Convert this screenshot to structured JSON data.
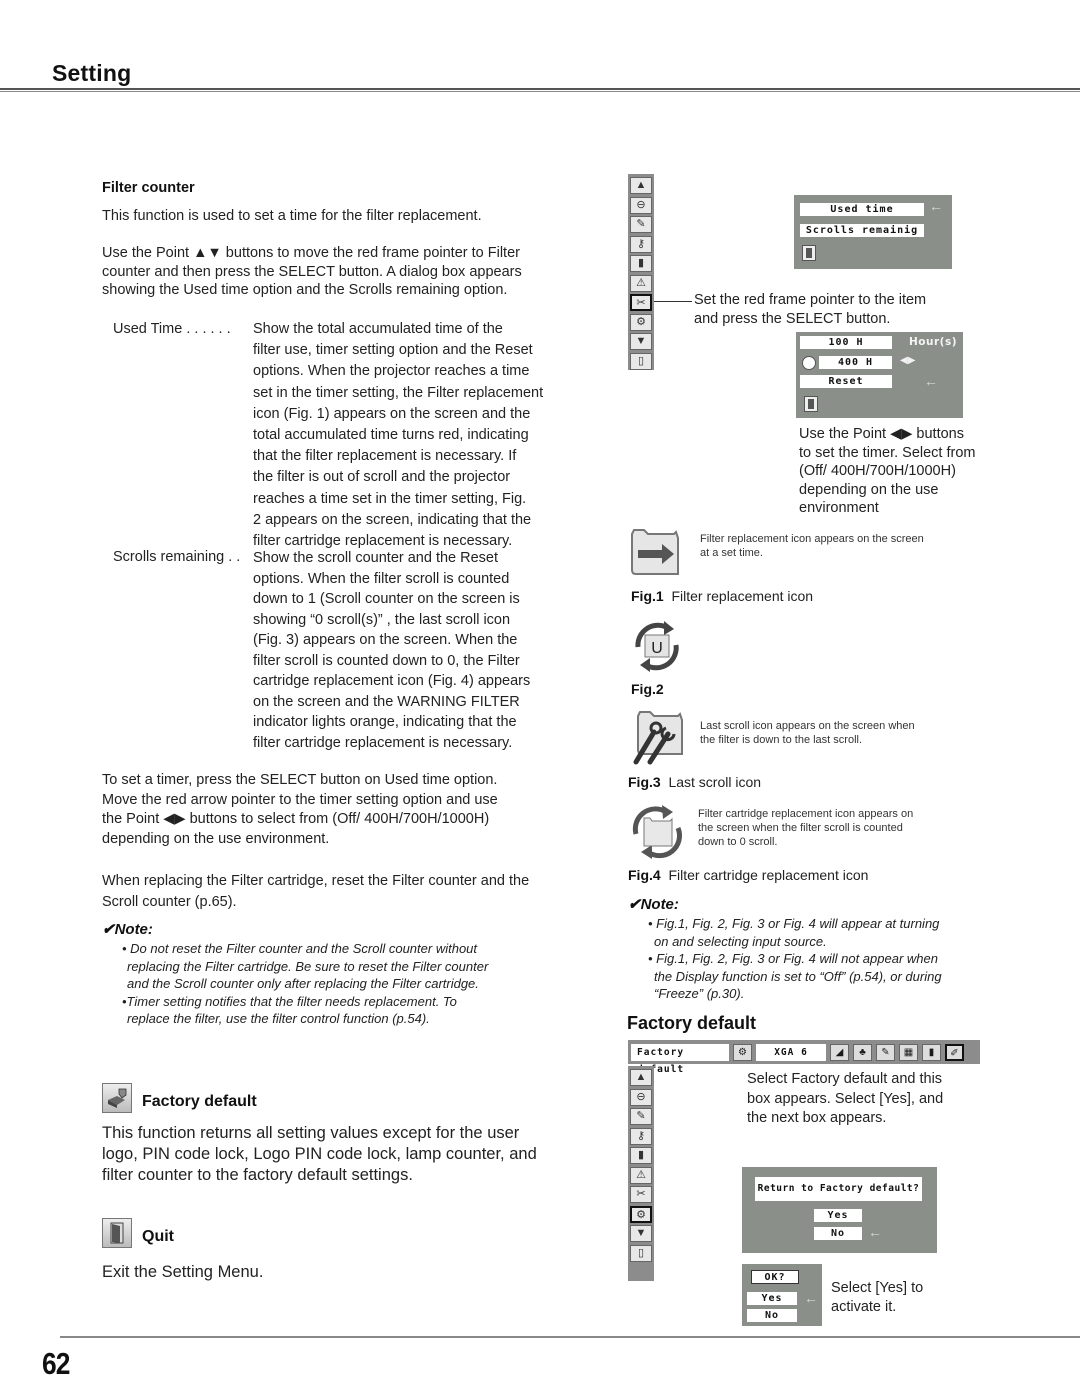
{
  "header": {
    "title": "Setting"
  },
  "left": {
    "filter_counter": {
      "heading": "Filter counter",
      "intro": "This function is used to set a time for the filter replacement.",
      "para1_lines": [
        "Use the Point ▲▼ buttons to move the red frame pointer to Filter",
        "counter and then press the SELECT button. A dialog box appears",
        "showing the Used time option and the Scrolls remaining option."
      ],
      "used_time": {
        "term": "Used Time . . . . . .",
        "lines": [
          "Show the total accumulated time of the",
          "filter use, timer setting option and the Reset",
          "options. When the projector reaches a time",
          "set in the timer setting, the Filter replacement",
          "icon (Fig. 1) appears on the screen and the",
          "total accumulated time turns red, indicating",
          "that the filter replacement is necessary. If",
          "the filter is out of scroll and the projector",
          "reaches a time set in the timer setting, Fig.",
          "2 appears on the screen, indicating that the",
          "filter cartridge replacement is necessary."
        ]
      },
      "scrolls_remaining": {
        "term": "Scrolls remaining . .",
        "lines": [
          "Show the scroll counter and the Reset",
          "options. When the filter scroll is counted",
          "down to 1 (Scroll counter on the screen is",
          "showing “0 scroll(s)” , the last scroll icon",
          "(Fig. 3) appears on the screen. When the",
          "filter scroll is counted down to 0, the Filter",
          "cartridge replacement icon (Fig. 4) appears",
          "on the screen and the WARNING FILTER",
          "indicator lights orange, indicating that the",
          "filter cartridge replacement is necessary."
        ]
      },
      "para2_lines": [
        "To set a timer, press the SELECT button on Used time option.",
        "Move the red arrow pointer to the timer setting option and use",
        "the Point ◀▶ buttons to select from (Off/ 400H/700H/1000H)",
        "depending on the use environment."
      ],
      "para3_lines": [
        "When replacing the Filter cartridge, reset the Filter counter and the",
        "Scroll counter (p.65)."
      ],
      "note": {
        "heading": "✔Note:",
        "items": [
          [
            "• Do not reset the Filter counter and the Scroll counter without",
            "replacing the Filter cartridge.  Be sure to reset the Filter counter",
            "and the Scroll counter only after replacing the Filter cartridge."
          ],
          [
            "•Timer setting notifies that the filter needs replacement. To",
            "replace the filter, use the filter control function (p.54)."
          ]
        ]
      }
    },
    "factory_default": {
      "heading": "Factory default",
      "icon": "factory-default-icon",
      "lines": [
        "This function returns all setting values except for the user",
        "logo, PIN code lock, Logo PIN code lock, lamp counter, and",
        "filter counter to the factory default settings."
      ]
    },
    "quit": {
      "heading": "Quit",
      "icon": "quit-door-icon",
      "text": "Exit the Setting Menu."
    }
  },
  "right": {
    "side_menu_icons": [
      "up-arrow-icon",
      "input-icon",
      "logo-icon",
      "key-icon",
      "display-icon",
      "warning-icon",
      "filter-counter-icon",
      "factory-default-icon",
      "down-arrow-icon",
      "quit-door-icon"
    ],
    "filter_dialog": {
      "items": [
        "Used time",
        "Scrolls remainig"
      ],
      "pointer": "←"
    },
    "callout1": [
      "Set the red frame pointer to the item",
      "and press the SELECT button."
    ],
    "timer_dialog": {
      "used_value": "100 H",
      "used_unit": "Hour(s)",
      "timer_value": "400 H",
      "timer_arrows": "◀▶",
      "reset": "Reset",
      "pointer": "←"
    },
    "callout2": [
      "Use the Point ◀▶ buttons",
      "to set the timer. Select from",
      "(Off/ 400H/700H/1000H)",
      "depending on the use",
      "environment"
    ],
    "figs": [
      {
        "desc": [
          "Filter replacement icon appears on the screen",
          "at a set time."
        ],
        "num": "Fig.1",
        "label": "Filter replacement icon",
        "icon": "filter-replacement-icon"
      },
      {
        "desc": [],
        "num": "Fig.2",
        "label": "",
        "icon": "filter-cycle-u-icon"
      },
      {
        "desc": [
          "Last scroll icon appears on the screen when",
          "the filter is down to the last scroll."
        ],
        "num": "Fig.3",
        "label": "Last scroll icon",
        "icon": "last-scroll-icon"
      },
      {
        "desc": [
          "Filter cartridge replacement icon appears on",
          "the screen when the filter scroll is counted",
          "down to 0 scroll."
        ],
        "num": "Fig.4",
        "label": "Filter cartridge replacement icon",
        "icon": "filter-cartridge-icon"
      }
    ],
    "note": {
      "heading": "✔Note:",
      "items": [
        [
          "• Fig.1, Fig. 2, Fig. 3 or Fig. 4 will appear at turning",
          "on and selecting input source."
        ],
        [
          "• Fig.1, Fig. 2, Fig. 3 or Fig. 4 will not appear when",
          "the Display function is set to “Off” (p.54), or during",
          "“Freeze” (p.30)."
        ]
      ]
    },
    "factory_default": {
      "heading": "Factory default",
      "menubar_label": "Factory default",
      "menubar_mode": "XGA 6",
      "callout": [
        "Select Factory default and this",
        "box appears. Select [Yes], and",
        "the next box appears."
      ],
      "confirm_question": "Return to Factory  default?",
      "yes": "Yes",
      "no": "No",
      "pointer": "←",
      "ok_title": "OK?",
      "ok_yes": "Yes",
      "ok_no": "No",
      "ok_callout": [
        "Select [Yes] to",
        "activate it."
      ]
    }
  },
  "footer": {
    "page_number": "62"
  }
}
